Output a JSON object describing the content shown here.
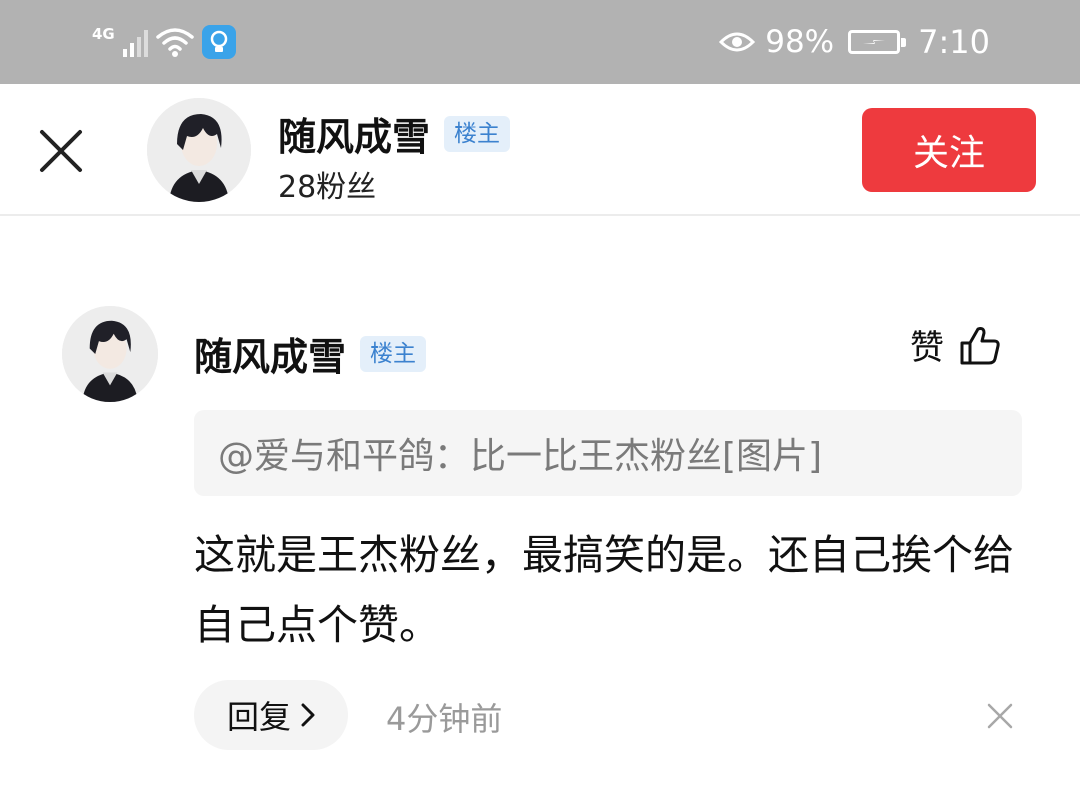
{
  "status_bar": {
    "network": "4G",
    "battery": "98%",
    "time": "7:10",
    "icons": [
      "signal-icon",
      "wifi-icon",
      "bulb-app-icon",
      "eye-icon",
      "battery-icon"
    ]
  },
  "header": {
    "author_name": "随风成雪",
    "author_badge": "楼主",
    "fans": "28粉丝",
    "follow_label": "关注",
    "accent": "#ee3a3e"
  },
  "comment": {
    "author_name": "随风成雪",
    "author_badge": "楼主",
    "like_label": "赞",
    "quote": "@爱与和平鸽：比一比王杰粉丝[图片]",
    "body": "这就是王杰粉丝，最搞笑的是。还自己挨个给自己点个赞。",
    "reply_label": "回复",
    "timestamp": "4分钟前"
  },
  "colors": {
    "status_bar_bg": "#b2b2b2",
    "badge_bg": "#e4effa",
    "badge_text": "#3c82cf"
  }
}
